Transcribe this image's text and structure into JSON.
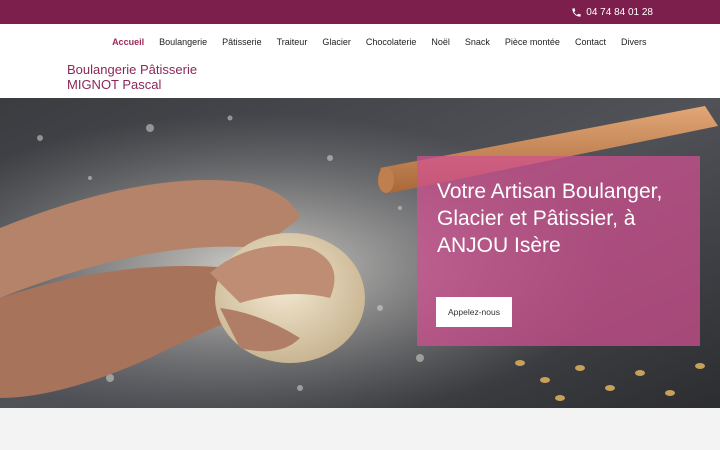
{
  "topbar": {
    "phone": "04 74 84 01 28",
    "phone_icon": "phone-icon",
    "bg": "#7d1f4d"
  },
  "nav": {
    "items": [
      "Accueil",
      "Boulangerie",
      "Pâtisserie",
      "Traiteur",
      "Glacier",
      "Chocolaterie",
      "Noël",
      "Snack",
      "Pièce montée",
      "Contact",
      "Divers"
    ],
    "active": "Accueil",
    "active_color": "#9b2a59"
  },
  "brand": {
    "line1": "Boulangerie Pâtisserie",
    "line2": "MIGNOT Pascal",
    "color": "#8b2758"
  },
  "hero": {
    "title": "Votre Artisan Boulanger, Glacier et Pâtissier, à ANJOU Isère",
    "cta_label": "Appelez-nous",
    "overlay_color": "#d15091"
  }
}
